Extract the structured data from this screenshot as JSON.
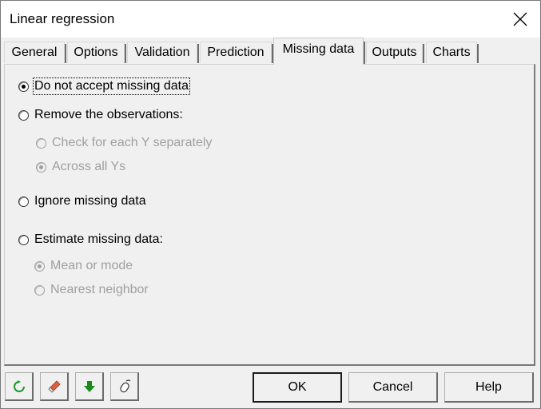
{
  "window": {
    "title": "Linear regression"
  },
  "tabs": [
    {
      "label": "General"
    },
    {
      "label": "Options"
    },
    {
      "label": "Validation"
    },
    {
      "label": "Prediction"
    },
    {
      "label": "Missing data"
    },
    {
      "label": "Outputs"
    },
    {
      "label": "Charts"
    }
  ],
  "active_tab": "Missing data",
  "options": {
    "do_not_accept": {
      "label": "Do not accept missing data",
      "checked": true,
      "enabled": true
    },
    "remove_observations": {
      "label": "Remove the observations:",
      "checked": false,
      "enabled": true,
      "sub": [
        {
          "label": "Check for each Y separately",
          "checked": false,
          "enabled": false
        },
        {
          "label": "Across all Ys",
          "checked": true,
          "enabled": false
        }
      ]
    },
    "ignore": {
      "label": "Ignore missing data",
      "checked": false,
      "enabled": true
    },
    "estimate": {
      "label": "Estimate missing data:",
      "checked": false,
      "enabled": true,
      "sub": [
        {
          "label": "Mean or mode",
          "checked": true,
          "enabled": false
        },
        {
          "label": "Nearest neighbor",
          "checked": false,
          "enabled": false
        }
      ]
    }
  },
  "toolbar_icons": [
    "reset-icon",
    "eraser-icon",
    "down-arrow-icon",
    "mouse-icon"
  ],
  "colors": {
    "reset_icon": "#1a9a2a",
    "down_arrow": "#1a8a1a",
    "eraser": "#e0603a"
  },
  "buttons": {
    "ok": "OK",
    "cancel": "Cancel",
    "help": "Help"
  }
}
